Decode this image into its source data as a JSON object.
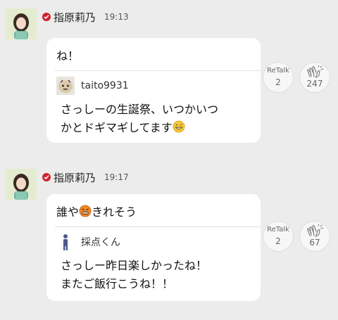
{
  "posts": [
    {
      "author": "指原莉乃",
      "time": "19:13",
      "text": "ね！",
      "quote": {
        "author": "taito9931",
        "line1": "さっしーの生誕祭、いつかいつ",
        "line2": "かとドギマギしてます"
      },
      "retalk": {
        "label": "ReTalk",
        "count": "2"
      },
      "claps": {
        "count": "247"
      }
    },
    {
      "author": "指原莉乃",
      "time": "19:17",
      "text_before": "誰や",
      "text_after": "きれそう",
      "quote": {
        "author": "採点くん",
        "line1": "さっしー昨日楽しかったね！",
        "line2": "またご飯行こうね！！"
      },
      "retalk": {
        "label": "ReTalk",
        "count": "2"
      },
      "claps": {
        "count": "67"
      }
    }
  ],
  "icons": {
    "verified": "verified-check-icon",
    "clap": "clap-icon",
    "grin": "grinning-emoji-icon",
    "angry": "angry-emoji-icon"
  },
  "colors": {
    "background": "#ececec",
    "verified": "#d0202a",
    "bubble": "#ffffff"
  }
}
